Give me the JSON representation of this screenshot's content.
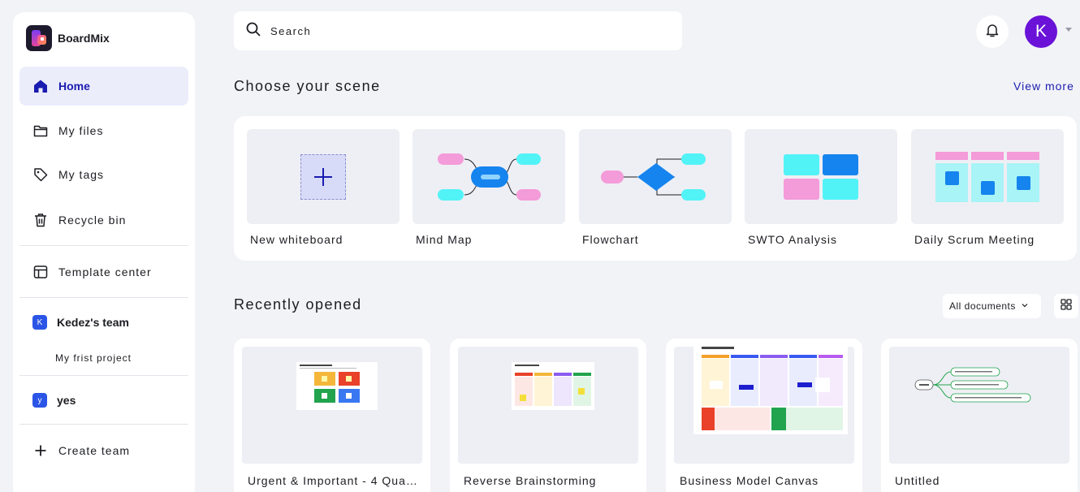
{
  "app": {
    "name": "BoardMix",
    "accent": "#1a1cb0",
    "avatar_color": "#6a12d8"
  },
  "sidebar": {
    "nav": [
      {
        "label": "Home",
        "icon": "home-icon",
        "active": true
      },
      {
        "label": "My files",
        "icon": "folder-icon"
      },
      {
        "label": "My tags",
        "icon": "tag-icon"
      },
      {
        "label": "Recycle bin",
        "icon": "trash-icon"
      }
    ],
    "template_center": {
      "label": "Template center",
      "icon": "template-icon"
    },
    "teams": [
      {
        "badge": "K",
        "name": "Kedez's team",
        "projects": [
          "My frist project"
        ]
      },
      {
        "badge": "y",
        "name": "yes",
        "projects": []
      }
    ],
    "create_team": {
      "label": "Create team",
      "icon": "plus-icon"
    }
  },
  "header": {
    "search_placeholder": "Search",
    "avatar_initial": "K"
  },
  "scenes": {
    "title": "Choose your scene",
    "view_more": "View more",
    "items": [
      {
        "label": "New whiteboard"
      },
      {
        "label": "Mind Map"
      },
      {
        "label": "Flowchart"
      },
      {
        "label": "SWTO Analysis"
      },
      {
        "label": "Daily Scrum Meeting"
      }
    ]
  },
  "recent": {
    "title": "Recently opened",
    "filter_label": "All documents",
    "items": [
      {
        "title": "Urgent & Important - 4 Quadrants"
      },
      {
        "title": "Reverse Brainstorming"
      },
      {
        "title": "Business Model Canvas"
      },
      {
        "title": "Untitled"
      }
    ]
  }
}
